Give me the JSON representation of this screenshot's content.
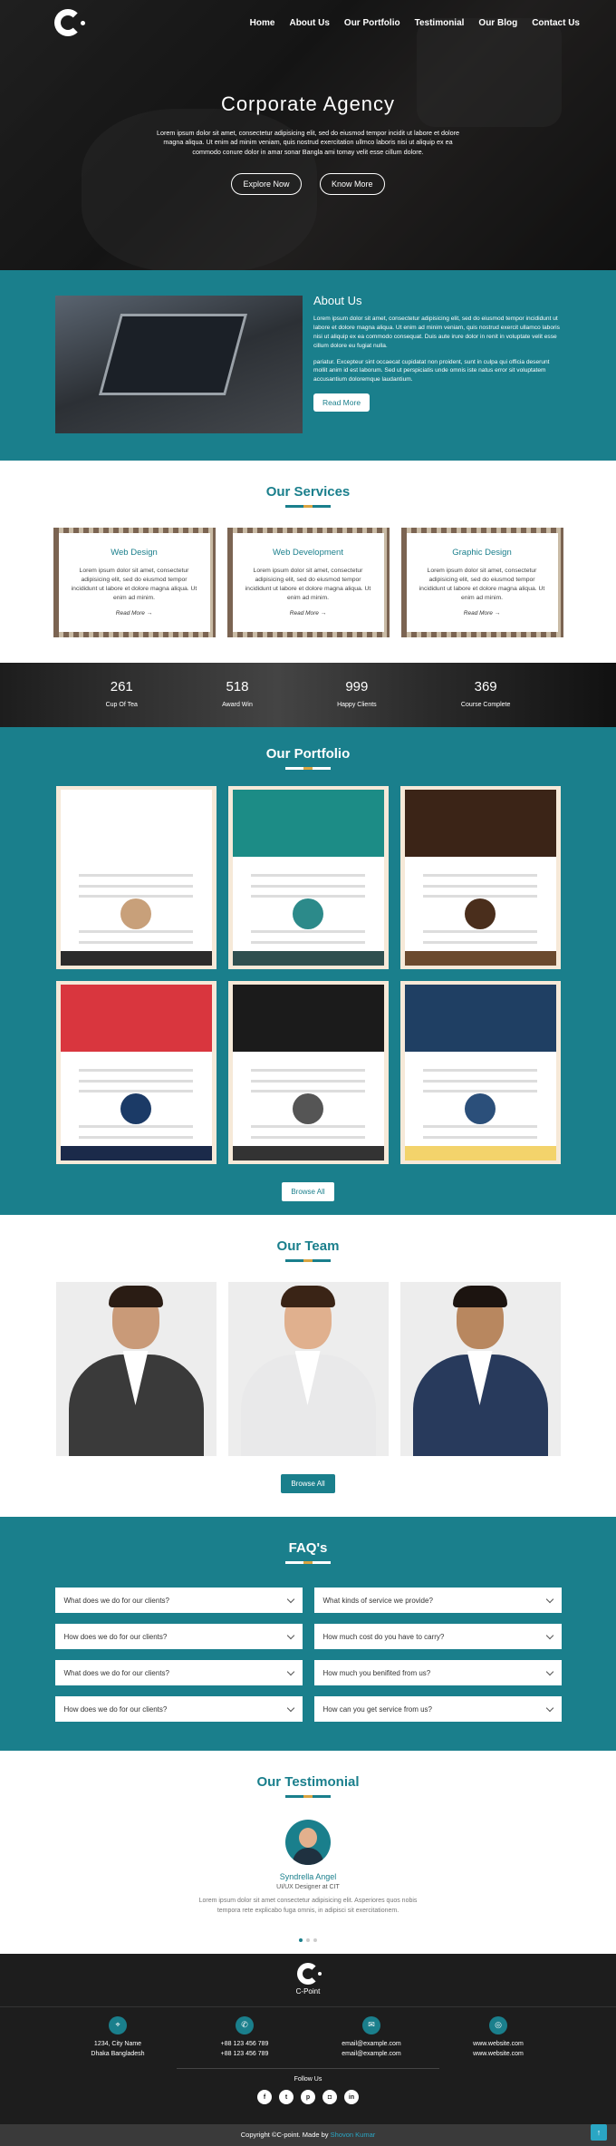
{
  "nav": {
    "logo_icon": "c-point-logo-icon",
    "items": [
      "Home",
      "About Us",
      "Our Portfolio",
      "Testimonial",
      "Our Blog",
      "Contact Us"
    ]
  },
  "hero": {
    "title": "Corporate Agency",
    "text": "Lorem ipsum dolor sit amet, consectetur adipisicing elit, sed do eiusmod tempor incidit ut labore et dolore magna aliqua. Ut enim ad minim veniam, quis nostrud exercitation ullmco laboris nisi ut aliquip ex ea commodo conure dolor in amar sonar Bangla ami tomay velit esse cillum dolore.",
    "btn1": "Explore Now",
    "btn2": "Know More"
  },
  "about": {
    "title": "About Us",
    "p1": "Lorem ipsum dolor sit amet, consectetur adipisicing elit, sed do eiusmod tempor incididunt ut labore et dolore magna aliqua. Ut enim ad minim veniam, quis nostrud exercit ullamco laboris nisi ut aliquip ex ea commodo consequat. Duis aute irure dolor in renit in voluptate velit esse cillum dolore eu fugiat nulla.",
    "p2": "pariatur. Excepteur sint occaecat cupidatat non proident, sunt in culpa qui officia deserunt mollit anim id est laborum. Sed ut perspiciatis unde omnis iste natus error sit voluptatem accusantium doloremque laudantium.",
    "btn": "Read More"
  },
  "services": {
    "title": "Our Services",
    "items": [
      {
        "title": "Web Design",
        "text": "Lorem ipsum dolor sit amet, consectetur adipisicing elit, sed do eiusmod tempor incididunt ut labore et dolore magna aliqua. Ut enim ad minim.",
        "link": "Read More →"
      },
      {
        "title": "Web Development",
        "text": "Lorem ipsum dolor sit amet, consectetur adipisicing elit, sed do eiusmod tempor incididunt ut labore et dolore magna aliqua. Ut enim ad minim.",
        "link": "Read More →"
      },
      {
        "title": "Graphic Design",
        "text": "Lorem ipsum dolor sit amet, consectetur adipisicing elit, sed do eiusmod tempor incididunt ut labore et dolore magna aliqua. Ut enim ad minim.",
        "link": "Read More →"
      }
    ]
  },
  "counters": [
    {
      "value": "261",
      "label": "Cup Of Tea"
    },
    {
      "value": "518",
      "label": "Award Win"
    },
    {
      "value": "999",
      "label": "Happy Clients"
    },
    {
      "value": "369",
      "label": "Course Complete"
    }
  ],
  "portfolio": {
    "title": "Our Portfolio",
    "button": "Browse All",
    "themes": [
      {
        "top": "#ffffff",
        "accent": "#2b2b2b",
        "dot": "#c8a07a"
      },
      {
        "top": "#1c8c86",
        "accent": "#2f4f4f",
        "dot": "#2c8a8a"
      },
      {
        "top": "#3b2417",
        "accent": "#6b4a2e",
        "dot": "#4a2e1c"
      },
      {
        "top": "#d9363e",
        "accent": "#1b2a4a",
        "dot": "#1b3a66"
      },
      {
        "top": "#1b1b1b",
        "accent": "#333333",
        "dot": "#555555"
      },
      {
        "top": "#1f3f63",
        "accent": "#f3d36b",
        "dot": "#2b4f7a"
      }
    ]
  },
  "team": {
    "title": "Our Team",
    "button": "Browse All",
    "members": [
      {
        "suit": "#3a3a3a",
        "skin": "#c99a78",
        "hair": "#2a1c14"
      },
      {
        "suit": "#e9e9ea",
        "skin": "#e0b08e",
        "hair": "#3a2416"
      },
      {
        "suit": "#283a5c",
        "skin": "#b8875f",
        "hair": "#1c1410"
      }
    ]
  },
  "faq": {
    "title": "FAQ's",
    "items": [
      "What does we do for our clients?",
      "What kinds of service we provide?",
      "How does we do for our clients?",
      "How much cost do you have to carry?",
      "What does we do for our clients?",
      "How much you benifited from us?",
      "How does we do for our clients?",
      "How can you get service from us?"
    ]
  },
  "testimonial": {
    "title": "Our Testimonial",
    "name": "Syndrella Angel",
    "role": "UI/UX Designer at CIT",
    "quote": "Lorem ipsum dolor sit amet consectetur adipisicing elit. Asperiores quos nobis tempora rete explicabo fuga omnis, in adipisci sit exercitationem."
  },
  "footer": {
    "brand": "C-Point",
    "columns": [
      {
        "icon": "map-pin-icon",
        "line1": "1234, City Name",
        "line2": "Dhaka Bangladesh"
      },
      {
        "icon": "phone-icon",
        "line1": "+88 123 456 789",
        "line2": "+88 123 456 789"
      },
      {
        "icon": "mail-icon",
        "line1": "email@example.com",
        "line2": "email@example.com"
      },
      {
        "icon": "globe-icon",
        "line1": "www.website.com",
        "line2": "www.website.com"
      }
    ],
    "follow": "Follow Us",
    "socials": [
      "facebook-icon",
      "twitter-icon",
      "pinterest-icon",
      "instagram-icon",
      "linkedin-icon"
    ],
    "copy_prefix": "Copyright ©C-point. Made by ",
    "copy_author": "Shovon Kumar"
  },
  "colors": {
    "primary": "#1a7f8c",
    "accent": "#d9a441",
    "link": "#2aa6c4",
    "footer": "#1d1d1d"
  }
}
